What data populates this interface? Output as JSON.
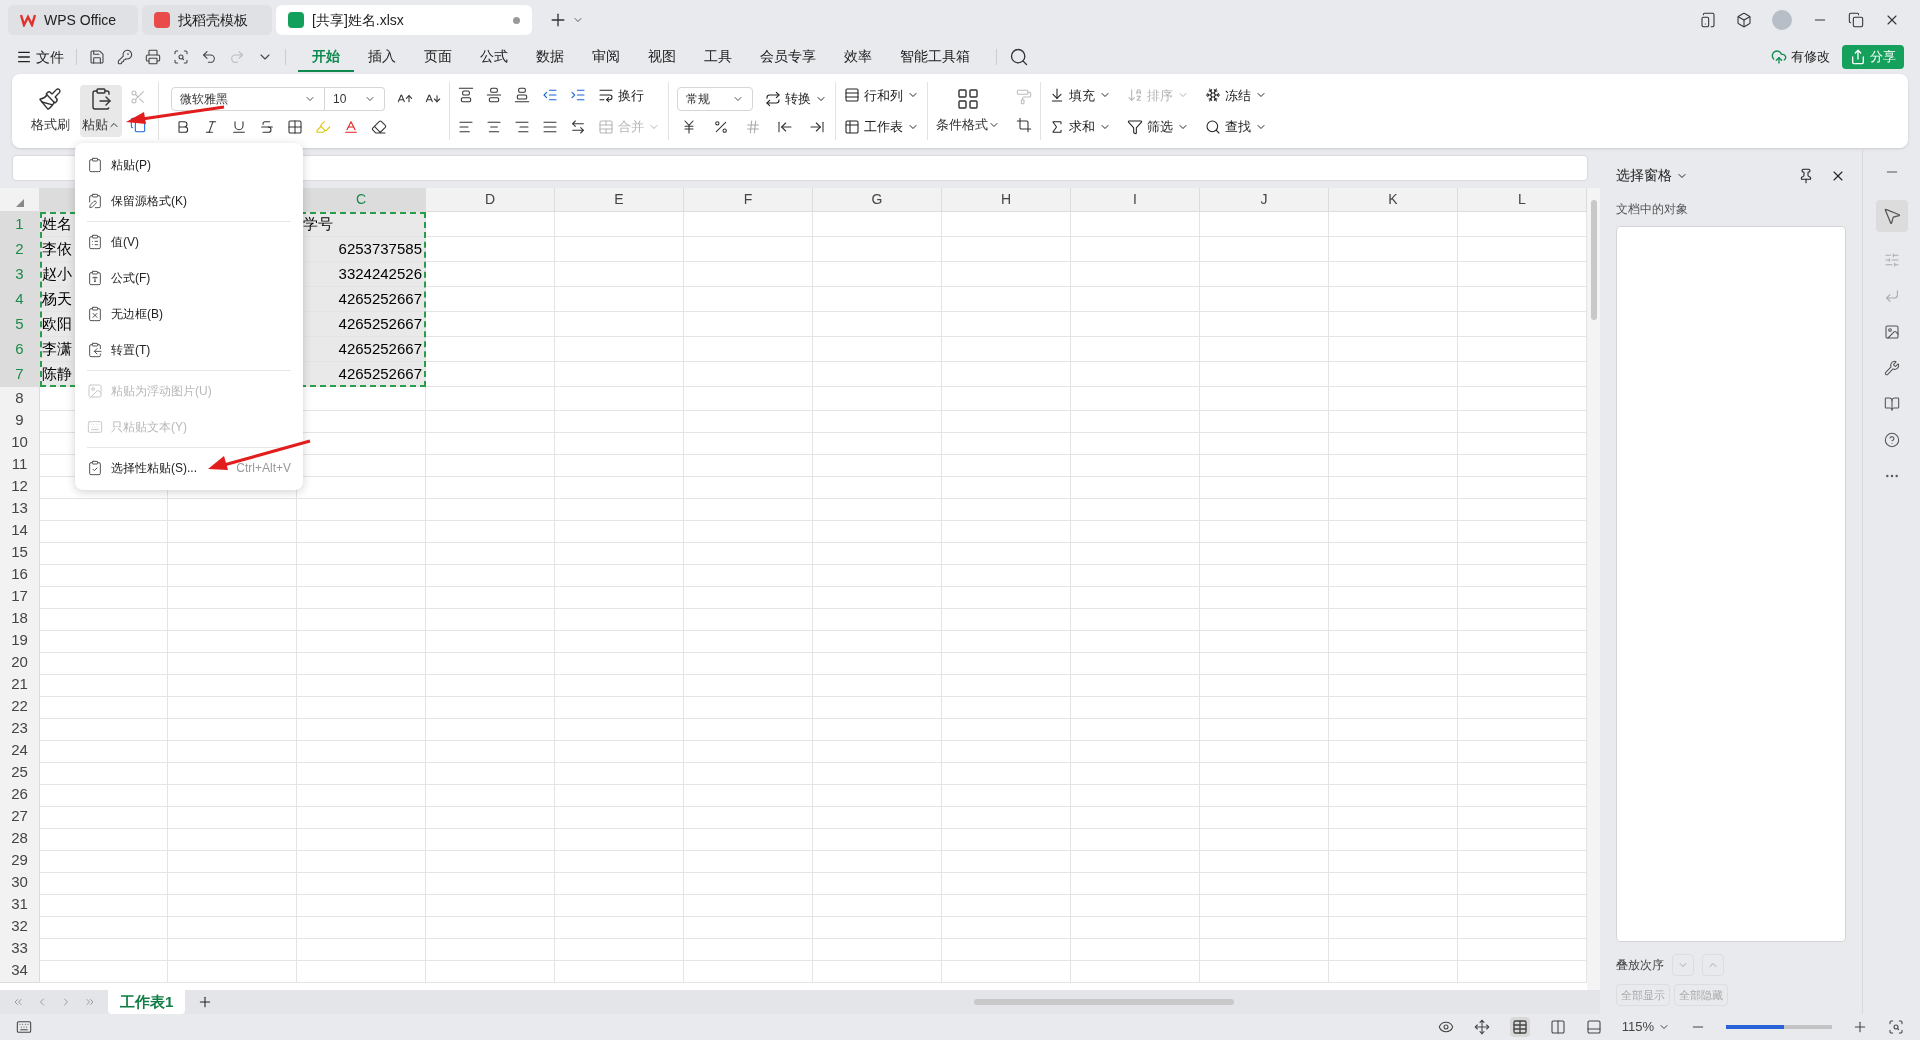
{
  "title_tabs": [
    {
      "label": "WPS Office",
      "kind": "wps",
      "selected": false
    },
    {
      "label": "找稻壳模板",
      "kind": "docer",
      "selected": false
    },
    {
      "label": "[共享]姓名.xlsx",
      "kind": "sheet",
      "selected": true,
      "modified": true
    }
  ],
  "menu_bar": {
    "file": "文件",
    "tabs": [
      {
        "label": "开始",
        "selected": true
      },
      {
        "label": "插入",
        "selected": false
      },
      {
        "label": "页面",
        "selected": false
      },
      {
        "label": "公式",
        "selected": false
      },
      {
        "label": "数据",
        "selected": false
      },
      {
        "label": "审阅",
        "selected": false
      },
      {
        "label": "视图",
        "selected": false
      },
      {
        "label": "工具",
        "selected": false
      },
      {
        "label": "会员专享",
        "selected": false
      },
      {
        "label": "效率",
        "selected": false
      },
      {
        "label": "智能工具箱",
        "selected": false
      }
    ],
    "sync_status": "有修改",
    "share": "分享"
  },
  "ribbon": {
    "format_painter": "格式刷",
    "paste": {
      "label": "粘贴",
      "expanded": true
    },
    "font_name": "微软雅黑",
    "font_size": "10",
    "wrap": "换行",
    "merge": {
      "label": "合并",
      "disabled": true
    },
    "number_format": "常规",
    "convert": "转换",
    "rows_cols": "行和列",
    "worksheet": "工作表",
    "conditional_format": "条件格式",
    "edit_tools": [
      {
        "label": "填充",
        "disabled": false
      },
      {
        "label": "排序",
        "disabled": true
      },
      {
        "label": "冻结",
        "disabled": false
      },
      {
        "label": "求和",
        "disabled": false
      },
      {
        "label": "筛选",
        "disabled": false
      },
      {
        "label": "查找",
        "disabled": false
      }
    ]
  },
  "paste_menu": {
    "groups": [
      [
        {
          "label": "粘贴(P)",
          "disabled": false
        },
        {
          "label": "保留源格式(K)",
          "disabled": false
        }
      ],
      [
        {
          "label": "值(V)",
          "disabled": false
        },
        {
          "label": "公式(F)",
          "disabled": false
        },
        {
          "label": "无边框(B)",
          "disabled": false
        },
        {
          "label": "转置(T)",
          "disabled": false
        }
      ],
      [
        {
          "label": "粘贴为浮动图片(U)",
          "disabled": true
        },
        {
          "label": "只粘贴文本(Y)",
          "disabled": true
        }
      ],
      [
        {
          "label": "选择性粘贴(S)...",
          "disabled": false,
          "shortcut": "Ctrl+Alt+V"
        }
      ]
    ]
  },
  "sheet": {
    "columns": [
      {
        "label": "C",
        "selected": true
      },
      {
        "label": "D",
        "selected": false
      },
      {
        "label": "E",
        "selected": false
      },
      {
        "label": "F",
        "selected": false
      },
      {
        "label": "G",
        "selected": false
      },
      {
        "label": "H",
        "selected": false
      },
      {
        "label": "I",
        "selected": false
      },
      {
        "label": "J",
        "selected": false
      },
      {
        "label": "K",
        "selected": false
      },
      {
        "label": "L",
        "selected": false
      }
    ],
    "rows": [
      {
        "number": "1",
        "selected": true,
        "a": "姓名",
        "c": "学号"
      },
      {
        "number": "2",
        "selected": true,
        "a": "李依",
        "c": "6253737585"
      },
      {
        "number": "3",
        "selected": true,
        "a": "赵小",
        "c": "3324242526"
      },
      {
        "number": "4",
        "selected": true,
        "a": "杨天",
        "c": "4265252667"
      },
      {
        "number": "5",
        "selected": true,
        "a": "欧阳",
        "c": "4265252667"
      },
      {
        "number": "6",
        "selected": true,
        "a": "李潇",
        "c": "4265252667"
      },
      {
        "number": "7",
        "selected": true,
        "a": "陈静",
        "c": "4265252667"
      },
      {
        "number": "8",
        "selected": false
      },
      {
        "number": "9",
        "selected": false
      },
      {
        "number": "10",
        "selected": false
      },
      {
        "number": "11",
        "selected": false
      },
      {
        "number": "12",
        "selected": false
      },
      {
        "number": "13",
        "selected": false
      },
      {
        "number": "14",
        "selected": false
      },
      {
        "number": "15",
        "selected": false
      },
      {
        "number": "16",
        "selected": false
      },
      {
        "number": "17",
        "selected": false
      },
      {
        "number": "18",
        "selected": false
      },
      {
        "number": "19",
        "selected": false
      },
      {
        "number": "20",
        "selected": false
      },
      {
        "number": "21",
        "selected": false
      },
      {
        "number": "22",
        "selected": false
      },
      {
        "number": "23",
        "selected": false
      },
      {
        "number": "24",
        "selected": false
      },
      {
        "number": "25",
        "selected": false
      },
      {
        "number": "26",
        "selected": false
      },
      {
        "number": "27",
        "selected": false
      },
      {
        "number": "28",
        "selected": false
      },
      {
        "number": "29",
        "selected": false
      },
      {
        "number": "30",
        "selected": false
      },
      {
        "number": "31",
        "selected": false
      },
      {
        "number": "32",
        "selected": false
      },
      {
        "number": "33",
        "selected": false
      },
      {
        "number": "34",
        "selected": false
      }
    ],
    "sheet_tabs": [
      {
        "label": "工作表1",
        "selected": true
      }
    ]
  },
  "selection_pane": {
    "title": "选择窗格",
    "subtitle": "文档中的对象",
    "order_label": "叠放次序",
    "buttons": [
      {
        "label": "全部显示",
        "disabled": true
      },
      {
        "label": "全部隐藏",
        "disabled": true
      }
    ]
  },
  "status_bar": {
    "zoom": "115%",
    "zoom_slider": {
      "level": 0.55
    }
  }
}
